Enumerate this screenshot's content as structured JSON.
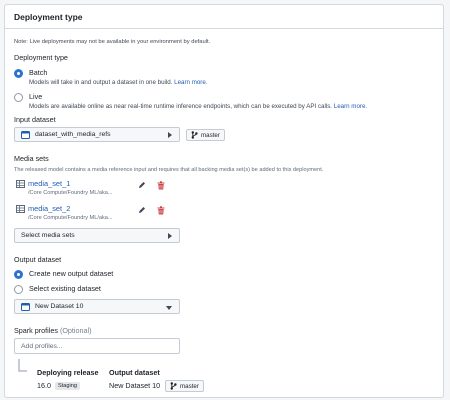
{
  "panel": {
    "title": "Deployment type"
  },
  "note": "Note: Live deployments may not be available in your environment by default.",
  "deployment_type": {
    "label": "Deployment type",
    "batch": {
      "label": "Batch",
      "desc": "Models will take in and output a dataset in one build.",
      "link": "Learn more."
    },
    "live": {
      "label": "Live",
      "desc": "Models are available online as near real-time runtime inference endpoints, which can be executed by API calls.",
      "link": "Learn more."
    },
    "selected": "Batch"
  },
  "input_dataset": {
    "label": "Input dataset",
    "value": "dataset_with_media_refs",
    "branch": "master"
  },
  "media_sets": {
    "label": "Media sets",
    "desc": "The released model contains a media reference input and requires that all backing media set(s) be added to this deployment.",
    "items": [
      {
        "name": "media_set_1",
        "path": "/Core Compute/Foundry ML/aka..."
      },
      {
        "name": "media_set_2",
        "path": "/Core Compute/Foundry ML/aka..."
      }
    ],
    "select_label": "Select media sets"
  },
  "output_dataset": {
    "label": "Output dataset",
    "create_label": "Create new output dataset",
    "select_label": "Select existing dataset",
    "selected": "Create new output dataset",
    "value": "New Dataset 10"
  },
  "spark": {
    "label": "Spark profiles",
    "optional": "(Optional)",
    "placeholder": "Add profiles..."
  },
  "summary": {
    "release_label": "Deploying release",
    "release_version": "16.0",
    "release_tag": "Staging",
    "output_label": "Output dataset",
    "output_value": "New Dataset 10",
    "output_branch": "master"
  },
  "colors": {
    "accent": "#2d72d2",
    "link": "#215db0",
    "delete": "#cd4246"
  }
}
